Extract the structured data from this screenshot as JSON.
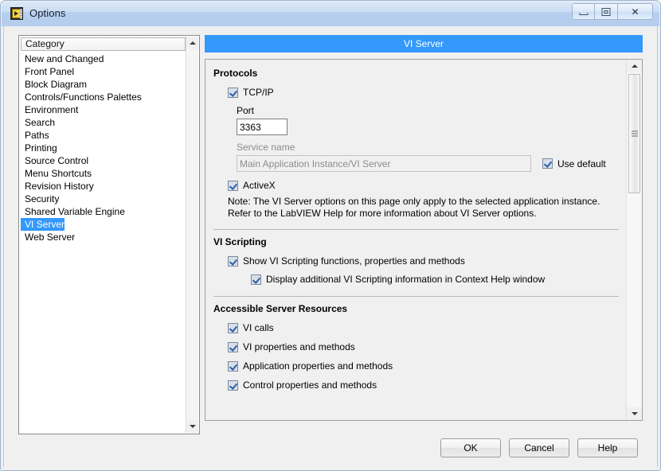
{
  "window": {
    "title": "Options",
    "icon": "labview-options-icon",
    "caption_buttons": [
      {
        "name": "minimize",
        "glyph": "minimize-icon"
      },
      {
        "name": "maximize",
        "glyph": "maximize-icon"
      },
      {
        "name": "close",
        "glyph": "✕"
      }
    ]
  },
  "category": {
    "header": "Category",
    "items": [
      {
        "label": "New and Changed",
        "selected": false
      },
      {
        "label": "Front Panel",
        "selected": false
      },
      {
        "label": "Block Diagram",
        "selected": false
      },
      {
        "label": "Controls/Functions Palettes",
        "selected": false
      },
      {
        "label": "Environment",
        "selected": false
      },
      {
        "label": "Search",
        "selected": false
      },
      {
        "label": "Paths",
        "selected": false
      },
      {
        "label": "Printing",
        "selected": false
      },
      {
        "label": "Source Control",
        "selected": false
      },
      {
        "label": "Menu Shortcuts",
        "selected": false
      },
      {
        "label": "Revision History",
        "selected": false
      },
      {
        "label": "Security",
        "selected": false
      },
      {
        "label": "Shared Variable Engine",
        "selected": false
      },
      {
        "label": "VI Server",
        "selected": true
      },
      {
        "label": "Web Server",
        "selected": false
      }
    ]
  },
  "pane": {
    "header": "VI Server",
    "protocols": {
      "title": "Protocols",
      "tcpip": {
        "label": "TCP/IP",
        "checked": true
      },
      "port": {
        "label": "Port",
        "value": "3363"
      },
      "service_name": {
        "label": "Service name",
        "value": "Main Application Instance/VI Server",
        "disabled": true
      },
      "use_default": {
        "label": "Use default",
        "checked": true
      },
      "activex": {
        "label": "ActiveX",
        "checked": true
      },
      "note": "Note: The VI Server options on this page only apply to the selected application instance. Refer to the LabVIEW Help for more information about VI Server options."
    },
    "vi_scripting": {
      "title": "VI Scripting",
      "show_functions": {
        "label": "Show VI Scripting functions, properties and methods",
        "checked": true
      },
      "display_additional": {
        "label": "Display additional VI Scripting information in Context Help window",
        "checked": true
      }
    },
    "accessible_resources": {
      "title": "Accessible Server Resources",
      "items": [
        {
          "label": "VI calls",
          "checked": true
        },
        {
          "label": "VI properties and methods",
          "checked": true
        },
        {
          "label": "Application properties and methods",
          "checked": true
        },
        {
          "label": "Control properties and methods",
          "checked": true
        }
      ]
    }
  },
  "footer": {
    "ok": "OK",
    "cancel": "Cancel",
    "help": "Help"
  },
  "colors": {
    "header_blue": "#3399fa",
    "selection_blue": "#3399ff",
    "titlebar_blue": "#b8d0ef",
    "window_bg": "#f0f0f0"
  }
}
